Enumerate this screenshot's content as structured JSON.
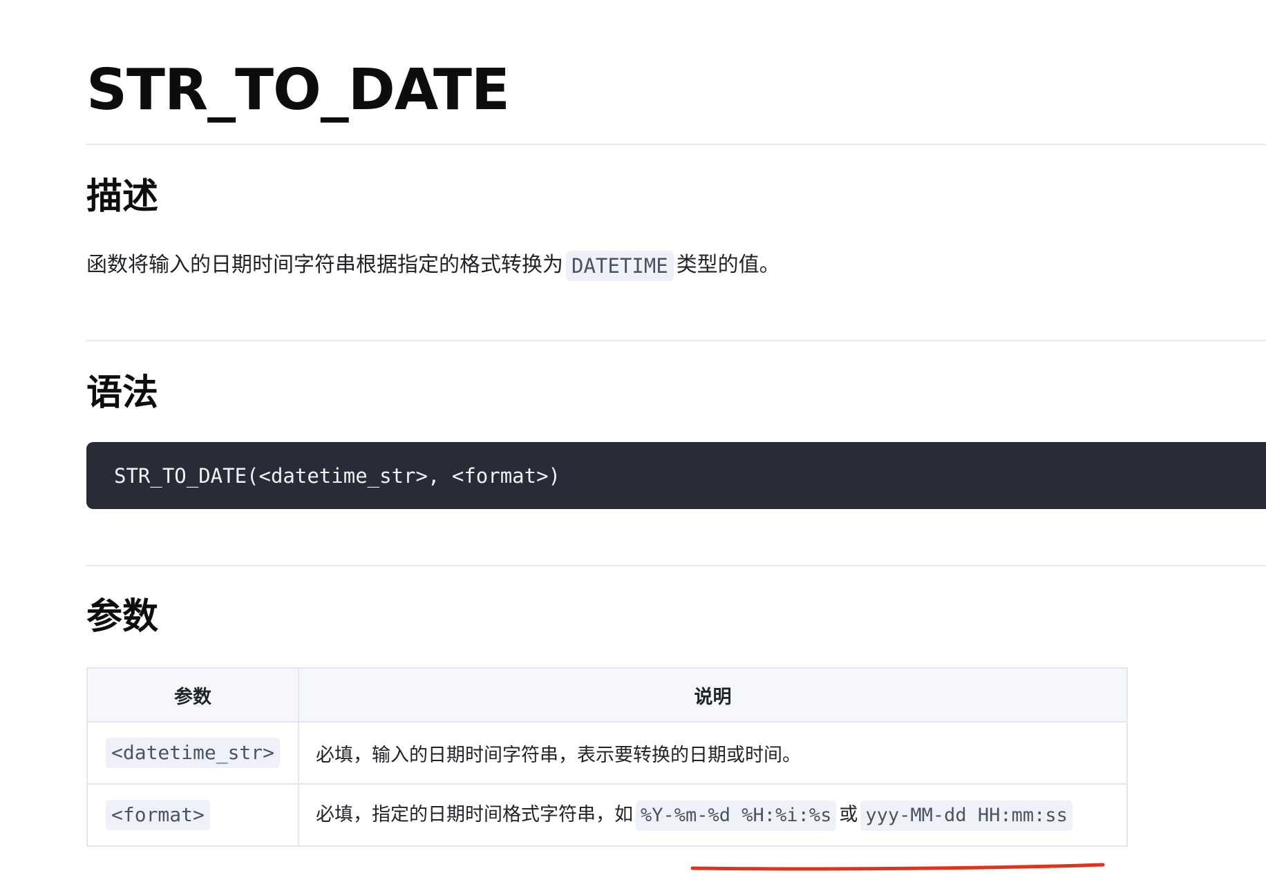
{
  "title": "STR_TO_DATE",
  "sections": {
    "description": {
      "heading": "描述",
      "text_before": "函数将输入的日期时间字符串根据指定的格式转换为",
      "code": "DATETIME",
      "text_after": "类型的值。"
    },
    "syntax": {
      "heading": "语法",
      "code": "STR_TO_DATE(<datetime_str>, <format>)"
    },
    "params": {
      "heading": "参数",
      "table": {
        "headers": [
          "参数",
          "说明"
        ],
        "rows": [
          {
            "param": "<datetime_str>",
            "desc_text": "必填，输入的日期时间字符串，表示要转换的日期或时间。"
          },
          {
            "param": "<format>",
            "desc_text": "必填，指定的日期时间格式字符串，如",
            "desc_code1": "%Y-%m-%d %H:%i:%s",
            "desc_join": "或",
            "desc_code2": "yyy-MM-dd HH:mm:ss"
          }
        ]
      }
    }
  },
  "colors": {
    "annotation": "#e0321e",
    "code_block_bg": "#282c38",
    "inline_code_bg": "#eef1f7"
  }
}
